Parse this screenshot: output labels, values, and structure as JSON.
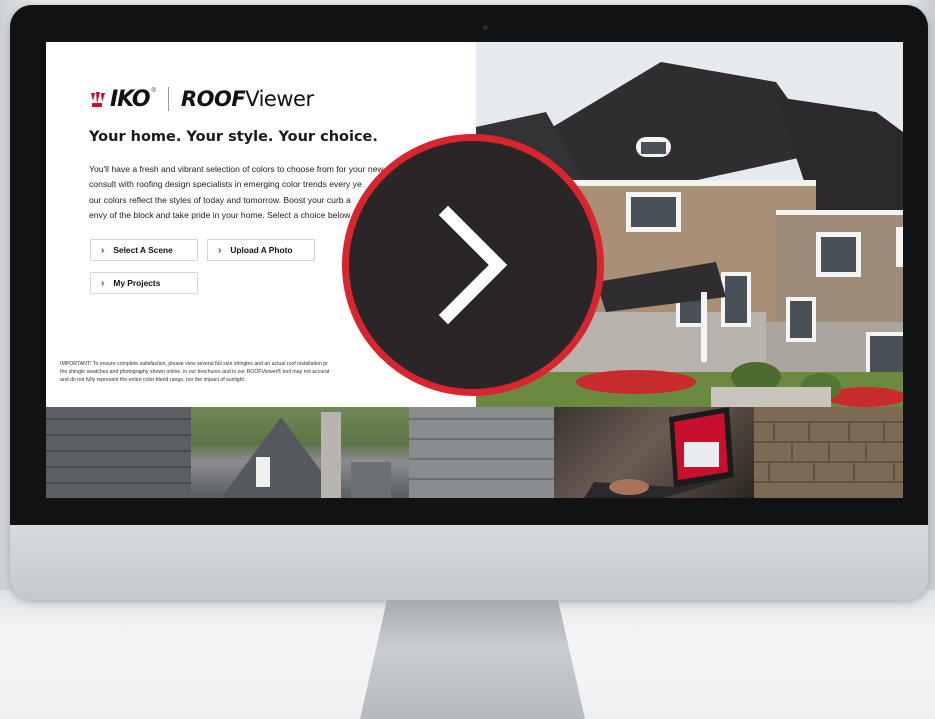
{
  "app": {
    "brand": "IKO",
    "product_bold": "ROOF",
    "product_rest": "Viewer",
    "registered_mark": "®"
  },
  "hero": {
    "headline": "Your home. Your style. Your choice.",
    "body": "You'll have a fresh and vibrant selection of colors to choose from for your new\nconsult with roofing design specialists in emerging color trends every ye\nour colors reflect the styles of today and tomorrow. Boost your curb a\nenvy of the block and take pride in your home. Select a choice below"
  },
  "actions": {
    "select_scene": "Select A Scene",
    "upload_photo": "Upload A Photo",
    "my_projects": "My Projects"
  },
  "disclaimer": "IMPORTANT! To ensure complete satisfaction, please view several full size shingles and an actual roof installation pr\nthe shingle swatches and photography shown online, in our brochures and in our ROOFViewer® tool may not accurat\nand do not fully represent the entire color blend range, nor the impact of sunlight.",
  "colors": {
    "accent": "#c8102e",
    "play_ring": "#d9252f",
    "play_fill": "#2a2526"
  },
  "icons": {
    "play": "chevron-right-icon",
    "button_chevron": "chevron-right-icon"
  }
}
